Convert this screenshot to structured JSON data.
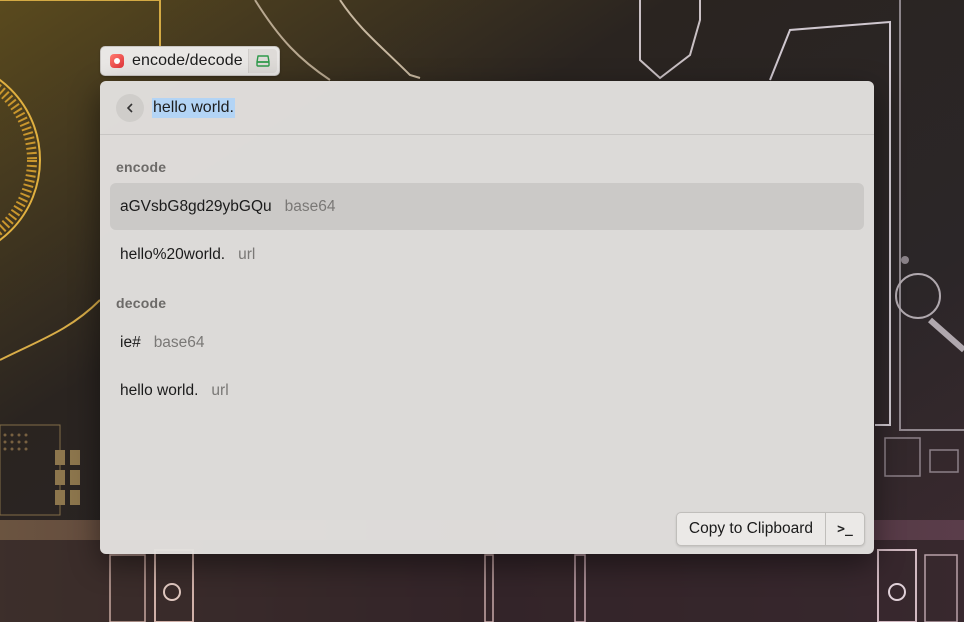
{
  "tag": {
    "label": "encode/decode",
    "app_icon": "raycast-icon",
    "extension_icon": "disk-icon"
  },
  "search": {
    "query": "hello world."
  },
  "sections": [
    {
      "title": "encode",
      "items": [
        {
          "value": "aGVsbG8gd29ybGQu",
          "kind": "base64",
          "selected": true
        },
        {
          "value": "hello%20world.",
          "kind": "url",
          "selected": false
        }
      ]
    },
    {
      "title": "decode",
      "items": [
        {
          "value": "ie#",
          "kind": "base64",
          "selected": false
        },
        {
          "value": "hello world.",
          "kind": "url",
          "selected": false
        }
      ]
    }
  ],
  "footer": {
    "copy_label": "Copy to Clipboard",
    "terminal_label": ">_"
  },
  "colors": {
    "selection_highlight": "#b3d4f5",
    "selected_row": "#cbc9c7",
    "panel_bg": "#e2e0de"
  }
}
